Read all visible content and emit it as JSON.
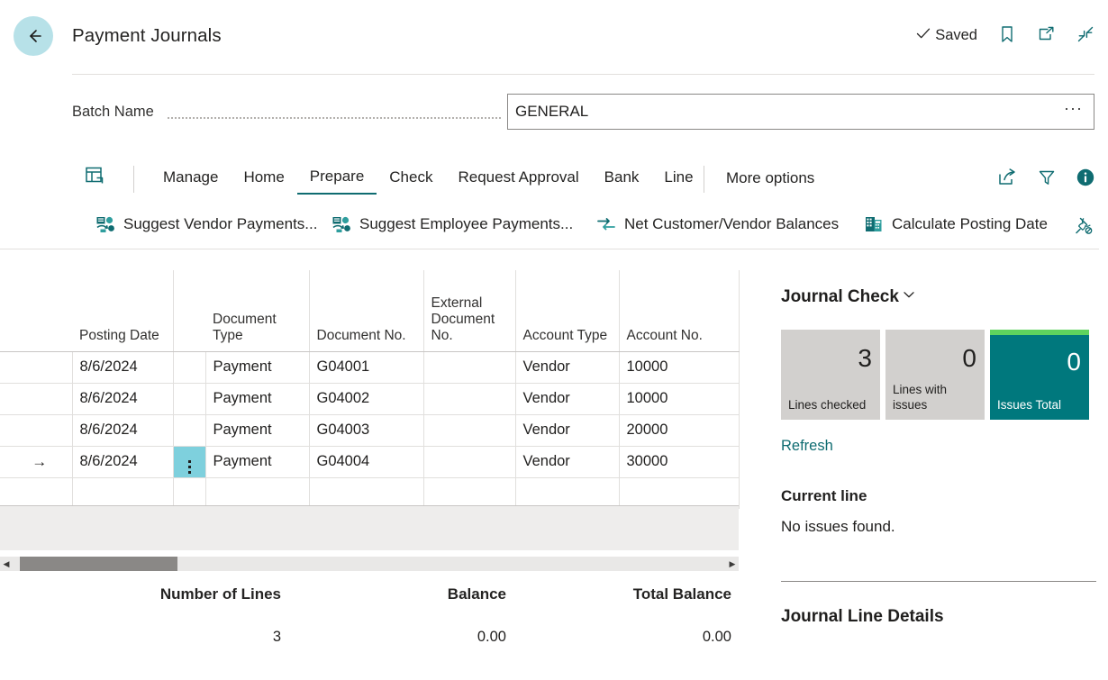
{
  "header": {
    "title": "Payment Journals",
    "back_icon": "back-arrow-icon",
    "saved_label": "Saved",
    "saved_icon": "checkmark-icon",
    "icons": [
      "bookmark-icon",
      "open-in-new-window-icon",
      "collapse-icon"
    ]
  },
  "batch": {
    "label": "Batch Name",
    "value": "GENERAL",
    "placeholder": "",
    "ellipsis": "···"
  },
  "ribbon": {
    "layout_icon": "page-layout-icon",
    "tabs": [
      {
        "label": "Manage",
        "active": false
      },
      {
        "label": "Home",
        "active": false
      },
      {
        "label": "Prepare",
        "active": true
      },
      {
        "label": "Check",
        "active": false
      },
      {
        "label": "Request Approval",
        "active": false
      },
      {
        "label": "Bank",
        "active": false
      },
      {
        "label": "Line",
        "active": false
      }
    ],
    "more_options": "More options",
    "right_icons": [
      "share-icon",
      "filter-icon",
      "info-icon"
    ],
    "accent_color": "#0f6c71"
  },
  "actions": {
    "items": [
      {
        "label": "Suggest Vendor Payments...",
        "icon": "suggest-vendor-payments-icon"
      },
      {
        "label": "Suggest Employee Payments...",
        "icon": "suggest-employee-payments-icon"
      },
      {
        "label": "Net Customer/Vendor Balances",
        "icon": "net-balances-icon"
      },
      {
        "label": "Calculate Posting Date",
        "icon": "calculate-posting-date-icon"
      }
    ],
    "pin_icon": "unpin-icon"
  },
  "grid": {
    "columns": [
      "",
      "Posting Date",
      "",
      "Document Type",
      "Document No.",
      "External Document No.",
      "Account Type",
      "Account No."
    ],
    "rows": [
      {
        "indicator": "",
        "posting_date": "8/6/2024",
        "menu": "",
        "document_type": "Payment",
        "document_no": "G04001",
        "external_document_no": "",
        "account_type": "Vendor",
        "account_no": "10000",
        "selected": false
      },
      {
        "indicator": "",
        "posting_date": "8/6/2024",
        "menu": "",
        "document_type": "Payment",
        "document_no": "G04002",
        "external_document_no": "",
        "account_type": "Vendor",
        "account_no": "10000",
        "selected": false
      },
      {
        "indicator": "",
        "posting_date": "8/6/2024",
        "menu": "",
        "document_type": "Payment",
        "document_no": "G04003",
        "external_document_no": "",
        "account_type": "Vendor",
        "account_no": "20000",
        "selected": false
      },
      {
        "indicator": "→",
        "posting_date": "8/6/2024",
        "menu": "kebab-menu-icon",
        "document_type": "Payment",
        "document_no": "G04004",
        "external_document_no": "",
        "account_type": "Vendor",
        "account_no": "30000",
        "selected": true
      },
      {
        "indicator": "",
        "posting_date": "",
        "menu": "",
        "document_type": "",
        "document_no": "",
        "external_document_no": "",
        "account_type": "",
        "account_no": "",
        "selected": false
      }
    ],
    "selected_cell_color": "#7ed0dd",
    "scrollbar": {
      "left_arrow": "◀",
      "right_arrow": "▶"
    }
  },
  "totals": {
    "labels": {
      "lines": "Number of Lines",
      "balance": "Balance",
      "total_balance": "Total Balance"
    },
    "values": {
      "lines": "3",
      "balance": "0.00",
      "total_balance": "0.00"
    }
  },
  "journal_check": {
    "title": "Journal Check",
    "chevron": "chevron-down-icon",
    "tiles": [
      {
        "value": "3",
        "caption": "Lines checked",
        "accent": false
      },
      {
        "value": "0",
        "caption": "Lines with issues",
        "accent": false
      },
      {
        "value": "0",
        "caption": "Issues Total",
        "accent": true
      }
    ],
    "accent_color": "#00787d",
    "accent_bar_color": "#5ed35e",
    "refresh_label": "Refresh",
    "current_line_heading": "Current line",
    "current_line_text": "No issues found.",
    "journal_line_details_heading": "Journal Line Details"
  }
}
